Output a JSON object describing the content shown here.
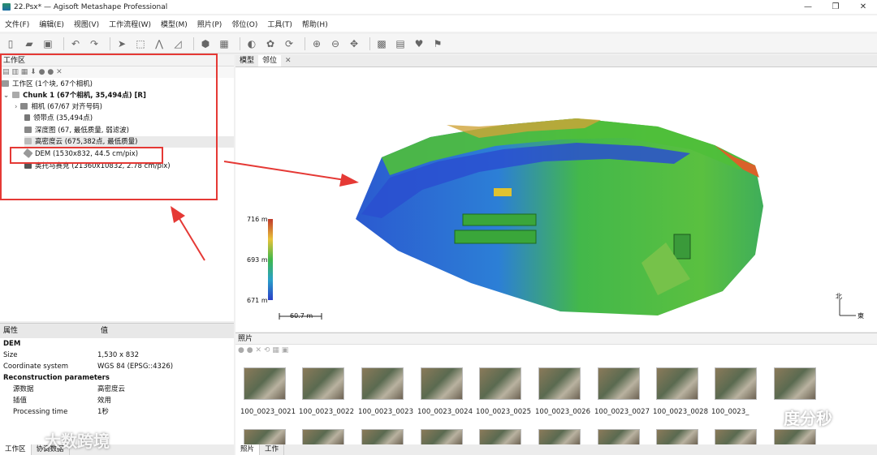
{
  "window": {
    "title": "22.Psx* — Agisoft Metashape Professional",
    "min": "—",
    "max": "❐",
    "close": "✕"
  },
  "menu": [
    "文件(F)",
    "编辑(E)",
    "视图(V)",
    "工作流程(W)",
    "模型(M)",
    "照片(P)",
    "邻位(O)",
    "工具(T)",
    "帮助(H)"
  ],
  "workspace": {
    "title": "工作区",
    "root": "工作区 (1个块, 67个相机)",
    "chunk": "Chunk 1 (67个相机, 35,494点) [R]",
    "items": [
      "相机 (67/67 对齐号码)",
      "领带点 (35,494点)",
      "深度图 (67, 最低质量, 弱滤波)",
      "高密度云 (675,382点, 最低质量)",
      "DEM (1530x832, 44.5 cm/pix)",
      "奥托马赛克 (21360x10832, 2.78 cm/pix)"
    ]
  },
  "properties": {
    "col_property": "属性",
    "col_value": "值",
    "section": "DEM",
    "rows": [
      {
        "k": "Size",
        "v": "1,530 x 832"
      },
      {
        "k": "Coordinate system",
        "v": "WGS 84 (EPSG::4326)"
      }
    ],
    "recon_title": "Reconstruction parameters",
    "recon": [
      {
        "k": "源数据",
        "v": "高密度云"
      },
      {
        "k": "插值",
        "v": "效用"
      },
      {
        "k": "Processing time",
        "v": "1秒"
      }
    ]
  },
  "bottom_tabs_left": [
    "工作区",
    "协调数据"
  ],
  "bottom_tabs_right": [
    "照片",
    "工作"
  ],
  "view_tabs": [
    "模型",
    "邻位"
  ],
  "legend": {
    "max": "716 m",
    "mid": "693 m",
    "min": "671 m",
    "scale": "60.7 m"
  },
  "compass": {
    "north": "北",
    "east": "東"
  },
  "photos": {
    "title": "照片",
    "labels": [
      "100_0023_0021",
      "100_0023_0022",
      "100_0023_0023",
      "100_0023_0024",
      "100_0023_0025",
      "100_0023_0026",
      "100_0023_0027",
      "100_0023_0028",
      "100_0023_"
    ]
  },
  "watermarks": {
    "left": "大数跨境",
    "right": "度分秒"
  },
  "colors": {
    "highlight": "#e53935",
    "arrow": "#e53935"
  }
}
